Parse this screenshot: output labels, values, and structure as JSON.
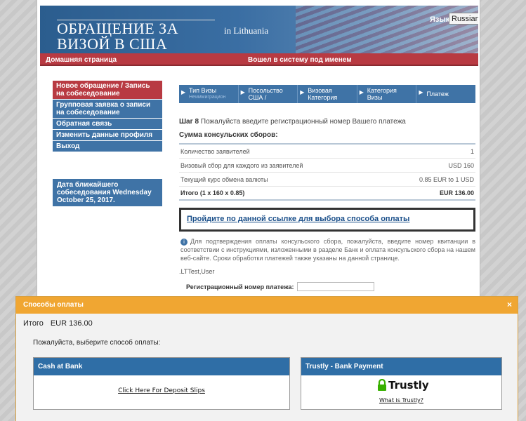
{
  "header": {
    "site_title": "ОБРАЩЕНИЕ ЗА ВИЗОЙ В США",
    "country": "in  Lithuania",
    "language_label": "Язык:",
    "language_value": "Russian",
    "home_link": "Домашняя страница",
    "logged_in_as": "Вошел в систему под именем"
  },
  "sidebar": {
    "items": [
      {
        "label": "Новое обращение / Запись на собеседование",
        "active": true
      },
      {
        "label": "Групповая заявка о записи на собеседование"
      },
      {
        "label": "Обратная связь"
      },
      {
        "label": "Изменить данные профиля"
      },
      {
        "label": "Выход"
      }
    ],
    "next_appointment": "Дата ближайшего собеседования Wednesday October 25, 2017."
  },
  "steps": [
    {
      "label": "Тип Визы",
      "sub": "Неиммиграцион"
    },
    {
      "label": "Посольство США /",
      "sub": ""
    },
    {
      "label": "Визовая Категория",
      "sub": ""
    },
    {
      "label": "Категория Визы",
      "sub": ""
    },
    {
      "label": "Платеж",
      "sub": ""
    }
  ],
  "content": {
    "step_no": "Шаг 8",
    "step_text": "Пожалуйста введите регистрационный номер Вашего платежа",
    "fees_title": "Сумма консульских сборов:",
    "rows": [
      {
        "label": "Количество заявителей",
        "value": "1"
      },
      {
        "label": "Визовый сбор для каждого из заявителей",
        "value": "USD 160"
      },
      {
        "label": "Текущий курс обмена валюты",
        "value": "0.85 EUR to 1 USD"
      }
    ],
    "total_label": "Итого (1 x 160 x 0.85)",
    "total_value": "EUR 136.00",
    "pay_link": "Пройдите по данной ссылке для выбора способа оплаты",
    "info": "Для подтверждения оплаты консульского сбора, пожалуйста, введите номер квитанции в соответствии с инструкциями, изложенными в разделе Банк и оплата консульского сбора на нашем веб-сайте. Сроки обработки платежей также указаны на данной странице.",
    "user": ".LTTest,User",
    "reg_label": "Регистрационный номер платежа:"
  },
  "overlay": {
    "title": "Способы оплаты",
    "close": "×",
    "total_label": "Итого",
    "total_value": "EUR 136.00",
    "choose": "Пожалуйста, выберите способ оплаты:",
    "bank": {
      "title": "Cash at Bank",
      "link": "Click Here For Deposit Slips"
    },
    "trustly": {
      "title": "Trustly - Bank Payment",
      "logo": "Trustly",
      "link": "What is Trustly?"
    }
  }
}
